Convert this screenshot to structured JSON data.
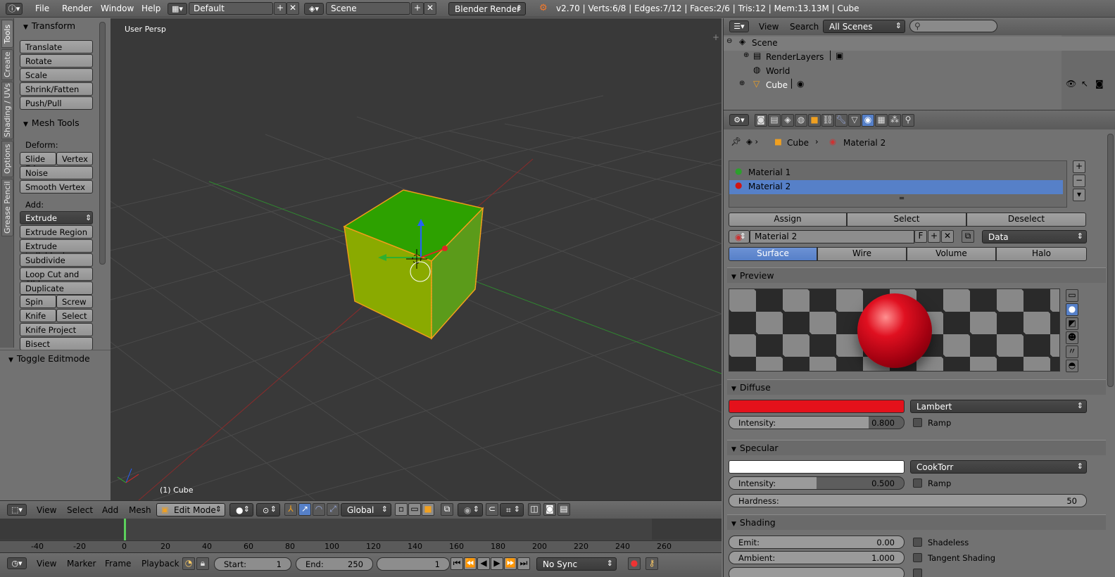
{
  "topbar": {
    "menus": [
      "File",
      "Render",
      "Window",
      "Help"
    ],
    "layout": "Default",
    "scene": "Scene",
    "engine": "Blender Render",
    "stats": "v2.70 | Verts:6/8 | Edges:7/12 | Faces:2/6 | Tris:12 | Mem:13.13M | Cube"
  },
  "tabs": [
    "Tools",
    "Create",
    "Shading / UVs",
    "Options",
    "Grease Pencil"
  ],
  "toolpanel": {
    "transform_header": "Transform",
    "transform_buttons": [
      "Translate",
      "Rotate",
      "Scale",
      "Shrink/Fatten",
      "Push/Pull"
    ],
    "mesh_tools_header": "Mesh Tools",
    "deform_label": "Deform:",
    "slide_edge": "Slide Ed",
    "vertex": "Vertex",
    "noise": "Noise",
    "smooth_vertex": "Smooth Vertex",
    "add_label": "Add:",
    "extrude": "Extrude",
    "extrude_region": "Extrude Region",
    "extrude_individual": "Extrude Individual",
    "subdivide": "Subdivide",
    "loop_cut": "Loop Cut and Slide",
    "duplicate": "Duplicate",
    "spin": "Spin",
    "screw": "Screw",
    "knife": "Knife",
    "select": "Select",
    "knife_project": "Knife Project",
    "bisect": "Bisect",
    "toggle_editmode": "Toggle Editmode"
  },
  "viewport": {
    "view_label": "User Persp",
    "object_label": "(1) Cube"
  },
  "view3d_header": {
    "menus": [
      "View",
      "Select",
      "Add",
      "Mesh"
    ],
    "mode": "Edit Mode",
    "orientation": "Global"
  },
  "timeline": {
    "ruler": [
      "-40",
      "-20",
      "0",
      "20",
      "40",
      "60",
      "80",
      "100",
      "120",
      "140",
      "160",
      "180",
      "200",
      "220",
      "240",
      "260"
    ],
    "menus": [
      "View",
      "Marker",
      "Frame",
      "Playback"
    ],
    "start_label": "Start:",
    "start_value": "1",
    "end_label": "End:",
    "end_value": "250",
    "current_frame": "1",
    "sync": "No Sync"
  },
  "outliner": {
    "menus": [
      "View",
      "Search"
    ],
    "filter": "All Scenes",
    "search_placeholder": "",
    "items": [
      "Scene",
      "RenderLayers",
      "World",
      "Cube"
    ]
  },
  "properties": {
    "breadcrumb": [
      "Cube",
      "Material 2"
    ],
    "materials": [
      "Material 1",
      "Material 2"
    ],
    "selected_material": "Material 2",
    "assign": "Assign",
    "select": "Select",
    "deselect": "Deselect",
    "material_name": "Material 2",
    "fake_user": "F",
    "link": "Data",
    "type_tabs": [
      "Surface",
      "Wire",
      "Volume",
      "Halo"
    ],
    "active_type": "Surface",
    "preview_header": "Preview",
    "diffuse_header": "Diffuse",
    "diffuse_color": "#e4111b",
    "diffuse_shader": "Lambert",
    "diffuse_intensity_label": "Intensity:",
    "diffuse_intensity": "0.800",
    "diffuse_intensity_fraction": 0.8,
    "ramp": "Ramp",
    "specular_header": "Specular",
    "specular_color": "#ffffff",
    "specular_shader": "CookTorr",
    "specular_intensity_label": "Intensity:",
    "specular_intensity": "0.500",
    "specular_intensity_fraction": 0.5,
    "hardness_label": "Hardness:",
    "hardness": "50",
    "shading_header": "Shading",
    "emit_label": "Emit:",
    "emit": "0.00",
    "ambient_label": "Ambient:",
    "ambient": "1.000",
    "shadeless": "Shadeless",
    "tangent_shading": "Tangent Shading"
  }
}
